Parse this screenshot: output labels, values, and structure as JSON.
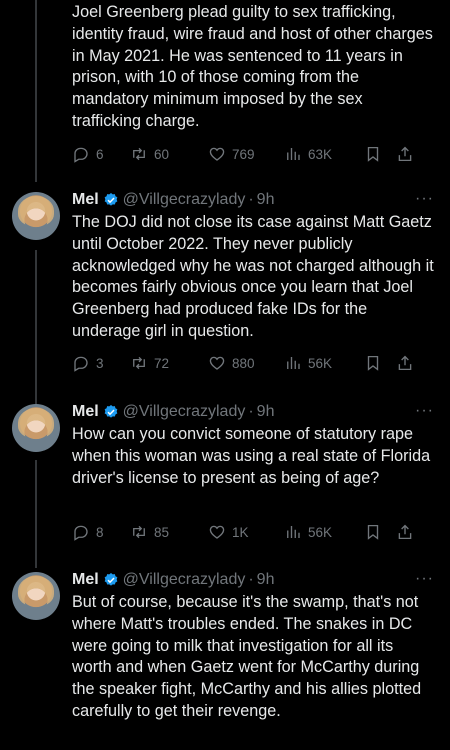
{
  "tweets": [
    {
      "text": "Joel Greenberg plead guilty to sex trafficking, identity fraud, wire fraud and host of other charges in May 2021. He was sentenced to 11 years in prison, with 10 of those coming from the mandatory minimum imposed by the sex trafficking charge.",
      "replies": "6",
      "retweets": "60",
      "likes": "769",
      "views": "63K"
    },
    {
      "name": "Mel",
      "handle": "@Villgecrazylady",
      "time": "9h",
      "text": "The DOJ did not close its case against Matt Gaetz until October 2022. They never publicly acknowledged why he was not charged although it becomes fairly obvious once you learn that Joel Greenberg had produced fake IDs for the underage girl in question.",
      "replies": "3",
      "retweets": "72",
      "likes": "880",
      "views": "56K"
    },
    {
      "name": "Mel",
      "handle": "@Villgecrazylady",
      "time": "9h",
      "text": "How can you convict someone of statutory rape when this woman was using a real state of Florida driver's license to present as being of age?",
      "replies": "8",
      "retweets": "85",
      "likes": "1K",
      "views": "56K"
    },
    {
      "name": "Mel",
      "handle": "@Villgecrazylady",
      "time": "9h",
      "text": "But of course, because it's the swamp, that's not where Matt's troubles ended. The snakes in DC were going to milk that investigation for all its worth and when Gaetz went for McCarthy during the speaker fight, McCarthy and his allies plotted carefully to get their revenge."
    }
  ],
  "dot": "·",
  "more": "···",
  "colors": {
    "background": "#000000",
    "text": "#e7e9ea",
    "muted": "#71767b",
    "verified": "#1d9bf0",
    "thread_line": "#333639"
  }
}
